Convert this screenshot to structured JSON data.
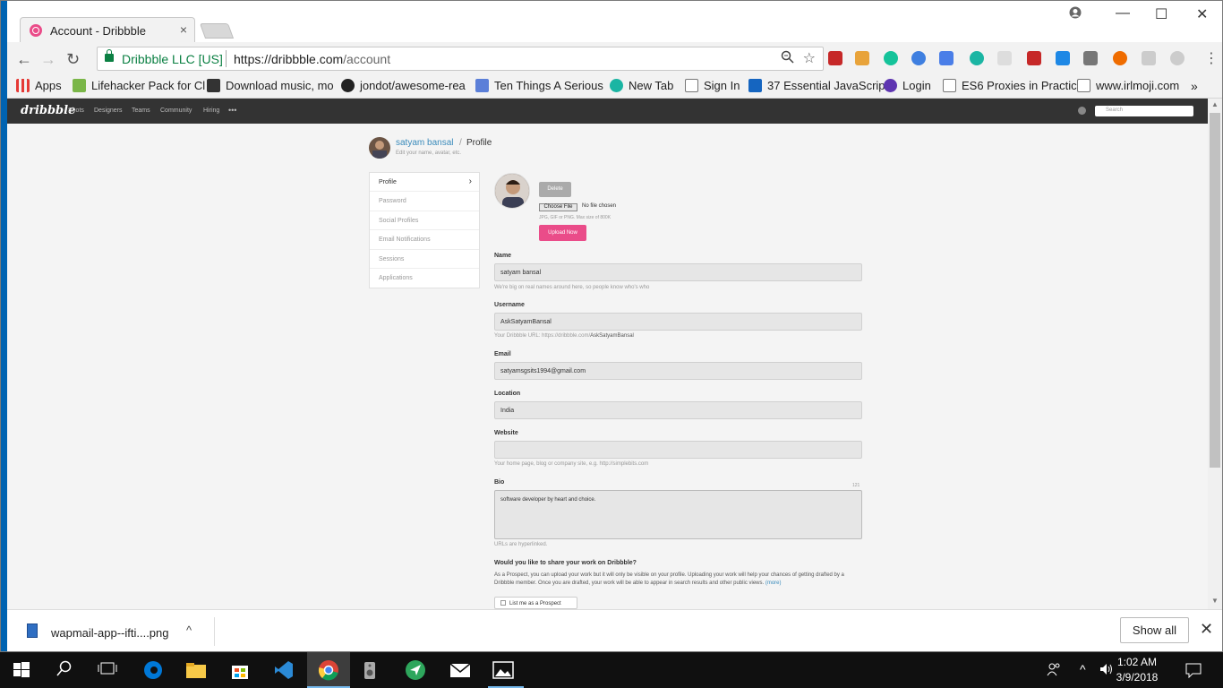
{
  "browser": {
    "tab_title": "Account - Dribbble",
    "tab_close": "×",
    "minimize": "—",
    "maximize": "☐",
    "close": "✕",
    "back": "←",
    "forward": "→",
    "reload": "↻",
    "org": "Dribbble LLC [US]",
    "url_host": "https://dribbble.com",
    "url_path": "/account",
    "more": "»"
  },
  "bookmarks": [
    {
      "label": "Apps",
      "color": "#e53935"
    },
    {
      "label": "Lifehacker Pack for Cl",
      "color": "#7ab648"
    },
    {
      "label": "Download music, mo",
      "color": "#333333"
    },
    {
      "label": "jondot/awesome-rea",
      "color": "#222222"
    },
    {
      "label": "Ten Things A Serious",
      "color": "#5b7fd8"
    },
    {
      "label": "New Tab",
      "color": "#1bb5a3"
    },
    {
      "label": "Sign In",
      "color": "#ffffff"
    },
    {
      "label": "37 Essential JavaScrip",
      "color": "#1565c0"
    },
    {
      "label": "Login",
      "color": "#5e35b1"
    },
    {
      "label": "ES6 Proxies in Practic",
      "color": "#ffffff"
    },
    {
      "label": "www.irlmoji.com",
      "color": "#ffffff"
    }
  ],
  "dribbble": {
    "logo": "dribbble",
    "nav": [
      "Shots",
      "Designers",
      "Teams",
      "Community",
      "Hiring",
      "•••"
    ],
    "search_placeholder": "Search"
  },
  "profile": {
    "name": "satyam bansal",
    "slash": "/",
    "section": "Profile",
    "subtitle": "Edit your name, avatar, etc."
  },
  "menu": [
    {
      "label": "Profile",
      "active": true
    },
    {
      "label": "Password"
    },
    {
      "label": "Social Profiles"
    },
    {
      "label": "Email Notifications"
    },
    {
      "label": "Sessions"
    },
    {
      "label": "Applications"
    }
  ],
  "avatar": {
    "delete": "Delete",
    "choose_file": "Choose File",
    "no_file": "No file chosen",
    "hint": "JPG, GIF or PNG. Max size of 800K",
    "upload": "Upload Now"
  },
  "form": {
    "name_label": "Name",
    "name_value": "satyam bansal",
    "name_hint": "We're big on real names around here, so people know who's who",
    "username_label": "Username",
    "username_value": "AskSatyamBansal",
    "username_hint": "Your Dribbble URL: https://dribbble.com/",
    "username_hint_strong": "AskSatyamBansal",
    "email_label": "Email",
    "email_value": "satyamsgsits1994@gmail.com",
    "location_label": "Location",
    "location_value": "India",
    "website_label": "Website",
    "website_value": "",
    "website_hint": "Your home page, blog or company site, e.g. http://simplebits.com",
    "bio_label": "Bio",
    "bio_count": "121",
    "bio_value": "software developer by heart and choice.",
    "bio_hint": "URLs are hyperlinked.",
    "prospect_title": "Would you like to share your work on Dribbble?",
    "prospect_desc": "As a Prospect, you can upload your work but it will only be visible on your profile. Uploading your work will help your chances of getting drafted by a Dribbble member. Once you are drafted, your work will be able to appear in search results and other public views.",
    "prospect_more": "(more)",
    "prospect_button": "List me as a Prospect"
  },
  "download": {
    "filename": "wapmail-app--ifti....png",
    "chevron": "^",
    "show_all": "Show all",
    "close": "✕"
  },
  "taskbar": {
    "time": "1:02 AM",
    "date": "3/9/2018"
  }
}
